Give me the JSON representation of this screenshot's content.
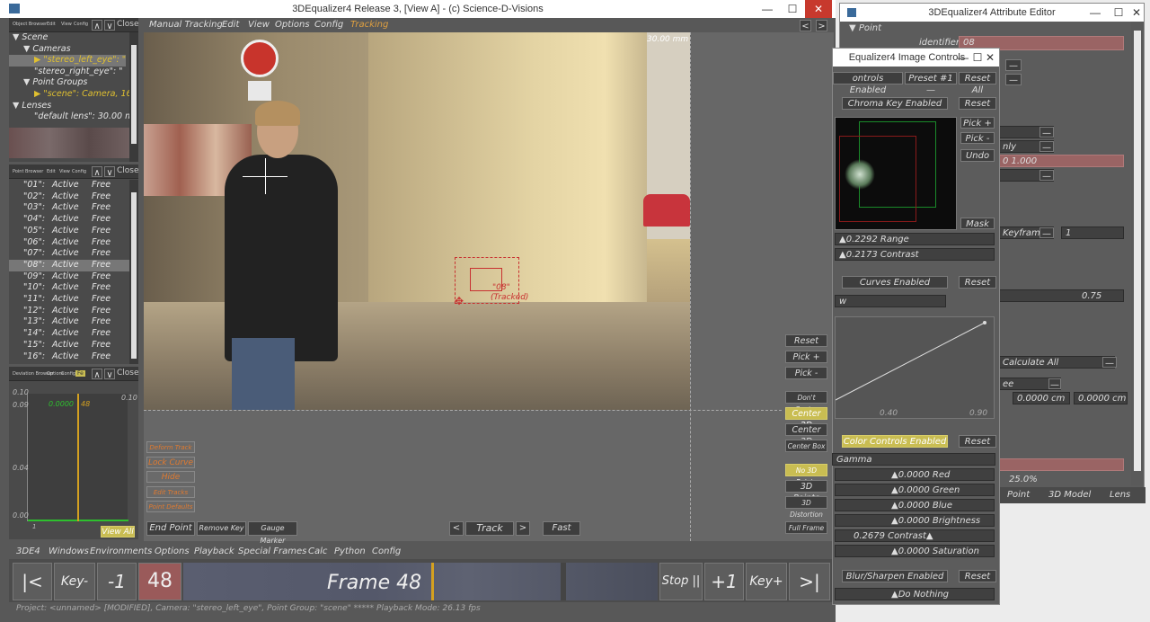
{
  "main": {
    "title": "3DEqualizer4 Release 3, [View A] - (c) Science-D-Visions",
    "menus": [
      "Manual Tracking",
      "Edit",
      "View",
      "Options",
      "Config",
      "Tracking"
    ],
    "lens_readout": "30.00 mm",
    "object_browser": {
      "tabs": [
        "Object Browser",
        "Edit",
        "View",
        "Config"
      ],
      "close": "Close",
      "tree": [
        {
          "label": "Scene",
          "indent": 0,
          "open": true
        },
        {
          "label": "Cameras",
          "indent": 1,
          "open": true
        },
        {
          "label": "\"stereo_left_eye\": \"",
          "indent": 2,
          "highlight": true,
          "selected": true
        },
        {
          "label": "\"stereo_right_eye\": \"",
          "indent": 2
        },
        {
          "label": "Point Groups",
          "indent": 1,
          "open": true
        },
        {
          "label": "\"scene\": Camera, 16",
          "indent": 2,
          "highlight": true
        },
        {
          "label": "Lenses",
          "indent": 0,
          "open": true
        },
        {
          "label": "\"default lens\": 30.00 m",
          "indent": 2
        }
      ]
    },
    "point_browser": {
      "tabs": [
        "Point Browser",
        "Edit",
        "View",
        "Config"
      ],
      "close": "Close",
      "points": [
        {
          "name": "\"01\":",
          "status": "Active",
          "mode": "Free"
        },
        {
          "name": "\"02\":",
          "status": "Active",
          "mode": "Free"
        },
        {
          "name": "\"03\":",
          "status": "Active",
          "mode": "Free"
        },
        {
          "name": "\"04\":",
          "status": "Active",
          "mode": "Free"
        },
        {
          "name": "\"05\":",
          "status": "Active",
          "mode": "Free"
        },
        {
          "name": "\"06\":",
          "status": "Active",
          "mode": "Free"
        },
        {
          "name": "\"07\":",
          "status": "Active",
          "mode": "Free"
        },
        {
          "name": "\"08\":",
          "status": "Active",
          "mode": "Free",
          "selected": true
        },
        {
          "name": "\"09\":",
          "status": "Active",
          "mode": "Free"
        },
        {
          "name": "\"10\":",
          "status": "Active",
          "mode": "Free"
        },
        {
          "name": "\"11\":",
          "status": "Active",
          "mode": "Free"
        },
        {
          "name": "\"12\":",
          "status": "Active",
          "mode": "Free"
        },
        {
          "name": "\"13\":",
          "status": "Active",
          "mode": "Free"
        },
        {
          "name": "\"14\":",
          "status": "Active",
          "mode": "Free"
        },
        {
          "name": "\"15\":",
          "status": "Active",
          "mode": "Free"
        },
        {
          "name": "\"16\":",
          "status": "Active",
          "mode": "Free"
        }
      ]
    },
    "deviation": {
      "tabs": [
        "Deviation Browser",
        "Options",
        "Config",
        "Fe"
      ],
      "close": "Close",
      "ytop": "0.10",
      "ytop_right": "0.10",
      "y1": "0.09",
      "y2": "0.04",
      "y3": "0.00",
      "cur_value": "0.0000",
      "cur_frame": "48",
      "x_start": "1",
      "view_all": "View All"
    },
    "left_tools": [
      "Deform Track",
      "Lock Curve",
      "Hide",
      "Edit Tracks",
      "Point Defaults"
    ],
    "bottom_tools": [
      "End Point",
      "Remove Key",
      "Gauge Marker"
    ],
    "track": {
      "prev": "<",
      "label": "Track",
      "next": ">",
      "fast": "Fast"
    },
    "right_tools": [
      "Reset",
      "Pick +",
      "Pick -",
      "Don't Center",
      "Center 2D",
      "Center 3D",
      "Center Box",
      "No 3D Points",
      "3D Points",
      "3D Distortion",
      "Full Frame"
    ],
    "tracker": {
      "name": "\"08\"",
      "status": "(Tracked)"
    },
    "bottom_menu": [
      "3DE4",
      "Windows",
      "Environments",
      "Options",
      "Playback",
      "Special Frames",
      "Calc",
      "Python",
      "Config"
    ],
    "timeline": {
      "first": "|<",
      "keyprev": "Key-",
      "minus1": "-1",
      "frame": "48",
      "frame_label": "Frame 48",
      "stop": "Stop ||",
      "plus1": "+1",
      "keynext": "Key+",
      "last": ">|"
    },
    "status": "Project: <unnamed> [MODIFIED], Camera: \"stereo_left_eye\", Point Group: \"scene\" ***** Playback Mode: 26.13 fps"
  },
  "attr": {
    "title": "3DEqualizer4 Attribute Editor",
    "section": "Point",
    "identifier_label": "identifier",
    "identifier": "08",
    "only": "nly",
    "value": "0 1.000",
    "keyframe": "Keyframe",
    "keyval": "1",
    "slider": "0.75",
    "calc_all": "Calculate All",
    "ee": "ee",
    "cm1": "0.0000 cm",
    "cm2": "0.0000 cm",
    "pct": "25.0%",
    "tabs": [
      "Point",
      "3D Model",
      "Lens"
    ]
  },
  "img": {
    "title": "Equalizer4 Image Controls",
    "enabled": "ontrols Enabled",
    "preset": "Preset #1",
    "reset_all": "Reset All",
    "chroma": "Chroma Key Enabled",
    "reset": "Reset",
    "pick_plus": "Pick +",
    "pick_minus": "Pick -",
    "undo": "Undo",
    "mask": "Mask",
    "range": "0.2292 Range",
    "contrast": "0.2173 Contrast",
    "curves": "Curves Enabled",
    "curve_x1": "0.40",
    "curve_x2": "0.90",
    "w": "w",
    "color_controls": "Color Controls Enabled",
    "gamma": "Gamma",
    "red": "0.0000 Red",
    "green": "0.0000 Green",
    "blue": "0.0000 Blue",
    "brightness": "0.0000 Brightness",
    "contrast2": "0.2679 Contrast",
    "saturation": "0.0000 Saturation",
    "blur": "Blur/Sharpen Enabled",
    "do_nothing": "Do Nothing"
  }
}
